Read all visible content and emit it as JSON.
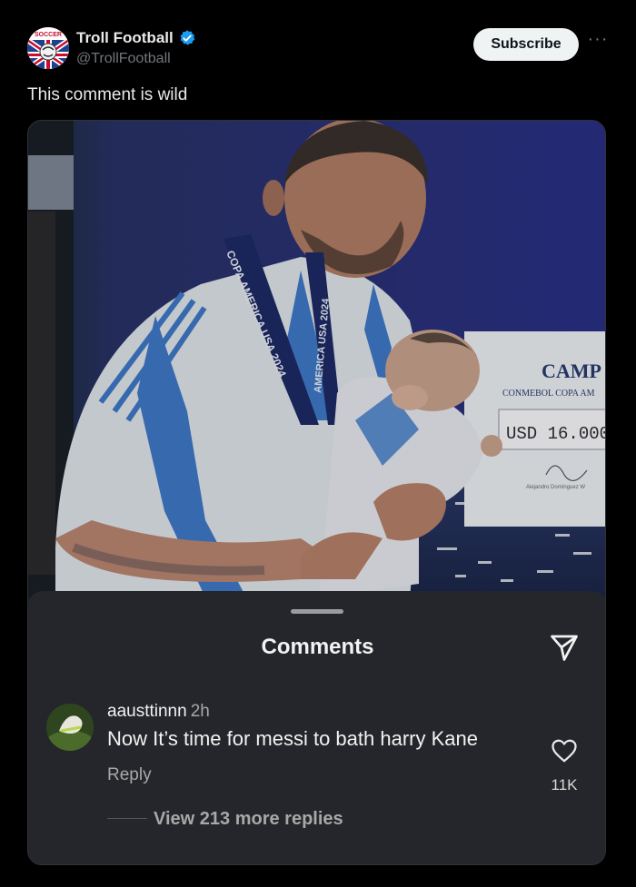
{
  "author": {
    "display_name": "Troll Football",
    "handle": "@TrollFootball",
    "avatar_text": "SOCCER",
    "verified_icon": "verified-badge-icon"
  },
  "actions": {
    "subscribe_label": "Subscribe",
    "more_label": "···"
  },
  "tweet": {
    "text": "This comment is wild"
  },
  "photo": {
    "lanyard_text": "COPA AMERICA USA 2024",
    "lanyard_text_2": "AMERICA USA 2024",
    "board_title": "CAMP",
    "board_subtitle": "CONMEBOL COPA AM",
    "board_amount": "USD 16.000",
    "board_signature": "Alejandro Domínguez W"
  },
  "comments_sheet": {
    "title": "Comments",
    "send_icon": "send-icon",
    "comment": {
      "username": "aausttinnn",
      "time": "2h",
      "text": "Now It’s time for messi to bath harry Kane",
      "reply_label": "Reply",
      "likes": "11K",
      "like_icon": "heart-icon"
    },
    "view_more": "View 213 more replies"
  },
  "colors": {
    "background": "#000000",
    "sheet": "#25262b",
    "verified": "#1d9bf0",
    "subscribe_bg": "#eff3f4"
  }
}
